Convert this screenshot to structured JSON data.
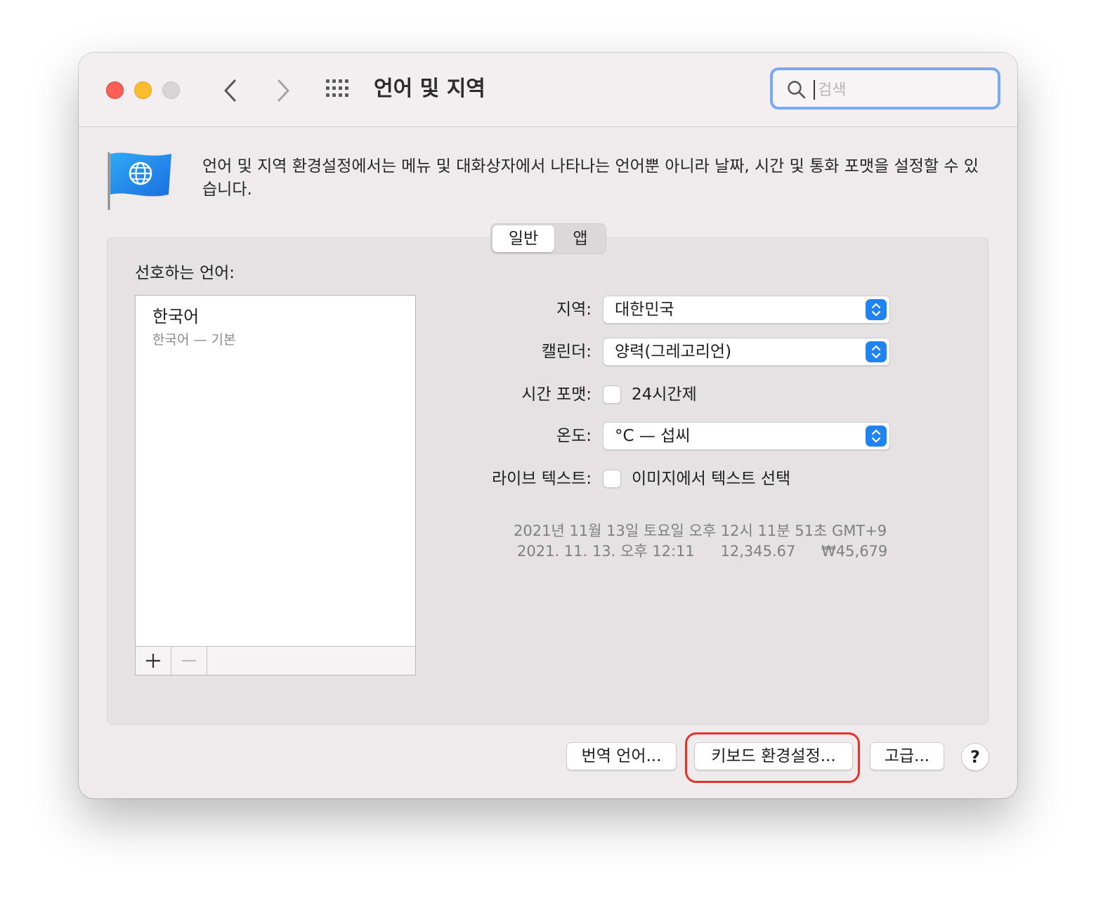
{
  "window": {
    "title": "언어 및 지역"
  },
  "search": {
    "placeholder": "검색"
  },
  "description": "언어 및 지역 환경설정에서는 메뉴 및 대화상자에서 나타나는 언어뿐 아니라 날짜, 시간 및 통화 포맷을 설정할 수 있습니다.",
  "tabs": [
    {
      "label": "일반",
      "active": true
    },
    {
      "label": "앱",
      "active": false
    }
  ],
  "preferred_languages": {
    "label": "선호하는 언어:",
    "items": [
      {
        "name": "한국어",
        "subtitle": "한국어 — 기본"
      }
    ],
    "add_label": "+",
    "remove_label": "—"
  },
  "settings": {
    "region": {
      "label": "지역:",
      "value": "대한민국"
    },
    "calendar": {
      "label": "캘린더:",
      "value": "양력(그레고리언)"
    },
    "time_format": {
      "label": "시간 포맷:",
      "checkbox_label": "24시간제",
      "checked": false
    },
    "temperature": {
      "label": "온도:",
      "value": "°C — 섭씨"
    },
    "live_text": {
      "label": "라이브 텍스트:",
      "checkbox_label": "이미지에서 텍스트 선택",
      "checked": false
    }
  },
  "sample": {
    "line1": "2021년 11월 13일 토요일 오후 12시 11분 51초 GMT+9",
    "date_short": "2021. 11. 13. 오후 12:11",
    "number": "12,345.67",
    "currency": "₩45,679"
  },
  "buttons": {
    "translation": "번역 언어...",
    "keyboard": "키보드 환경설정...",
    "advanced": "고급...",
    "help": "?"
  },
  "colors": {
    "accent": "#1f84f2",
    "highlight": "#e8312a",
    "close": "#fe5f57",
    "minimize": "#febc2e"
  }
}
